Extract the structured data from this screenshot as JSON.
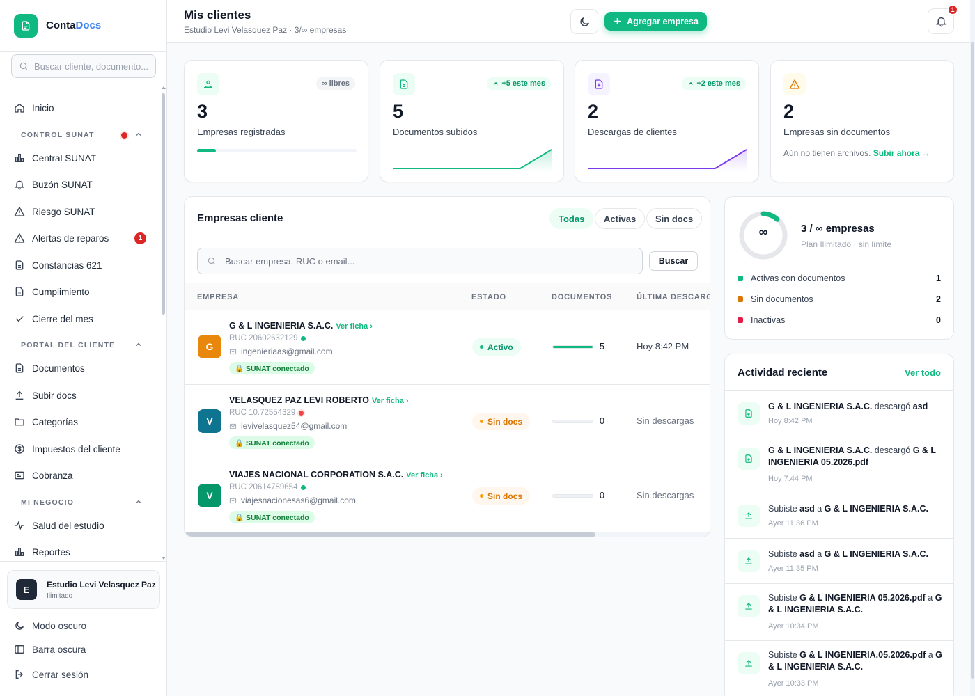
{
  "brand": {
    "name_part1": "Conta",
    "name_part2": "Docs"
  },
  "sidebar": {
    "search_placeholder": "Buscar cliente, documento...",
    "home": "Inicio",
    "sections": [
      {
        "title": "CONTROL SUNAT"
      },
      {
        "title": "PORTAL DEL CLIENTE"
      },
      {
        "title": "MI NEGOCIO"
      }
    ],
    "items": {
      "central": "Central SUNAT",
      "buzon": "Buzón SUNAT",
      "riesgo": "Riesgo SUNAT",
      "alertas": "Alertas de reparos",
      "alertas_badge": "1",
      "constancias": "Constancias 621",
      "cumplimiento": "Cumplimiento",
      "cierre": "Cierre del mes",
      "documentos": "Documentos",
      "subir": "Subir docs",
      "categorias": "Categorías",
      "impuestos": "Impuestos del cliente",
      "cobranza": "Cobranza",
      "salud": "Salud del estudio",
      "reportes": "Reportes"
    },
    "user": {
      "initial": "E",
      "name": "Estudio Levi Velasquez Paz",
      "plan": "Ilimitado"
    },
    "bottom": {
      "dark_mode": "Modo oscuro",
      "dark_bar": "Barra oscura",
      "logout": "Cerrar sesión"
    }
  },
  "header": {
    "title": "Mis clientes",
    "subtitle": "Estudio Levi Velasquez Paz · 3/∞ empresas",
    "add_button": "Agregar empresa",
    "notifications_badge": "1"
  },
  "stats": [
    {
      "value": "3",
      "label": "Empresas registradas",
      "pill": "∞ libres",
      "progress": 0.12
    },
    {
      "value": "5",
      "label": "Documentos subidos",
      "pill": "+5 este mes"
    },
    {
      "value": "2",
      "label": "Descargas de clientes",
      "pill": "+2 este mes"
    },
    {
      "value": "2",
      "label": "Empresas sin documentos",
      "note": "Aún no tienen archivos.",
      "note_link": "Subir ahora →"
    }
  ],
  "clients_table": {
    "title": "Empresas cliente",
    "filters": [
      "Todas",
      "Activas",
      "Sin docs"
    ],
    "search_placeholder": "Buscar empresa, RUC o email...",
    "search_button": "Buscar",
    "columns": [
      "EMPRESA",
      "ESTADO",
      "DOCUMENTOS",
      "ÚLTIMA DESCARGA"
    ],
    "view_link": "Ver ficha ›",
    "sunat_label": "🔒 SUNAT conectado",
    "rows": [
      {
        "initial": "G",
        "name": "G & L INGENIERIA S.A.C.",
        "ruc": "RUC 20602632129",
        "email": "ingenieriaas@gmail.com",
        "status": "Activo",
        "docs": "5",
        "docs_fraction": 1.0,
        "last_download": "Hoy 8:42 PM",
        "color": "#f59e0b"
      },
      {
        "initial": "V",
        "name": "VELASQUEZ PAZ LEVI ROBERTO",
        "ruc": "RUC 10.72554329",
        "email": "levivelasquez54@gmail.com",
        "status": "Sin docs",
        "docs": "0",
        "docs_fraction": 0,
        "last_download": "Sin descargas",
        "color": "#0e7490"
      },
      {
        "initial": "V",
        "name": "VIAJES NACIONAL CORPORATION S.A.C.",
        "ruc": "RUC 20614789654",
        "email": "viajesnacionesas6@gmail.com",
        "status": "Sin docs",
        "docs": "0",
        "docs_fraction": 0,
        "last_download": "Sin descargas",
        "color": "#059669"
      }
    ]
  },
  "plan": {
    "ring_symbol": "∞",
    "title": "3 / ∞ empresas",
    "subtitle": "Plan Ilimitado · sin límite",
    "legend": [
      {
        "label": "Activas con documentos",
        "value": "1",
        "color": "#10b981"
      },
      {
        "label": "Sin documentos",
        "value": "2",
        "color": "#d97706"
      },
      {
        "label": "Inactivas",
        "value": "0",
        "color": "#e11d48"
      }
    ]
  },
  "activity": {
    "title": "Actividad reciente",
    "view_all": "Ver todo",
    "items": [
      {
        "pre": "",
        "b1": "G & L INGENIERIA S.A.C.",
        "mid": " descargó ",
        "b2": "asd",
        "mid2": "",
        "b3": "",
        "time": "Hoy 8:42 PM",
        "icon": "download"
      },
      {
        "pre": "",
        "b1": "G & L INGENIERIA S.A.C.",
        "mid": " descargó ",
        "b2": "G & L INGENIERIA 05.2026.pdf",
        "mid2": "",
        "b3": "",
        "time": "Hoy 7:44 PM",
        "icon": "download"
      },
      {
        "pre": "Subiste ",
        "b1": "asd",
        "mid": " a ",
        "b2": "G & L INGENIERIA S.A.C.",
        "mid2": "",
        "b3": "",
        "time": "Ayer 11:36 PM",
        "icon": "upload"
      },
      {
        "pre": "Subiste ",
        "b1": "asd",
        "mid": " a ",
        "b2": "G & L INGENIERIA S.A.C.",
        "mid2": "",
        "b3": "",
        "time": "Ayer 11:35 PM",
        "icon": "upload"
      },
      {
        "pre": "Subiste ",
        "b1": "G & L INGENIERIA 05.2026.pdf",
        "mid": " a ",
        "b2": "G & L INGENIERIA S.A.C.",
        "mid2": "",
        "b3": "",
        "time": "Ayer 10:34 PM",
        "icon": "upload"
      },
      {
        "pre": "Subiste ",
        "b1": "G & L INGENIERIA.05.2026.pdf",
        "mid": " a ",
        "b2": "G & L INGENIERIA S.A.C.",
        "mid2": "",
        "b3": "",
        "time": "Ayer 10:33 PM",
        "icon": "upload"
      }
    ]
  },
  "colors": {
    "accent": "#10b981",
    "brand_blue": "#3b82f6",
    "danger": "#dc2626",
    "warning": "#d97706",
    "purple": "#7c3aed"
  }
}
